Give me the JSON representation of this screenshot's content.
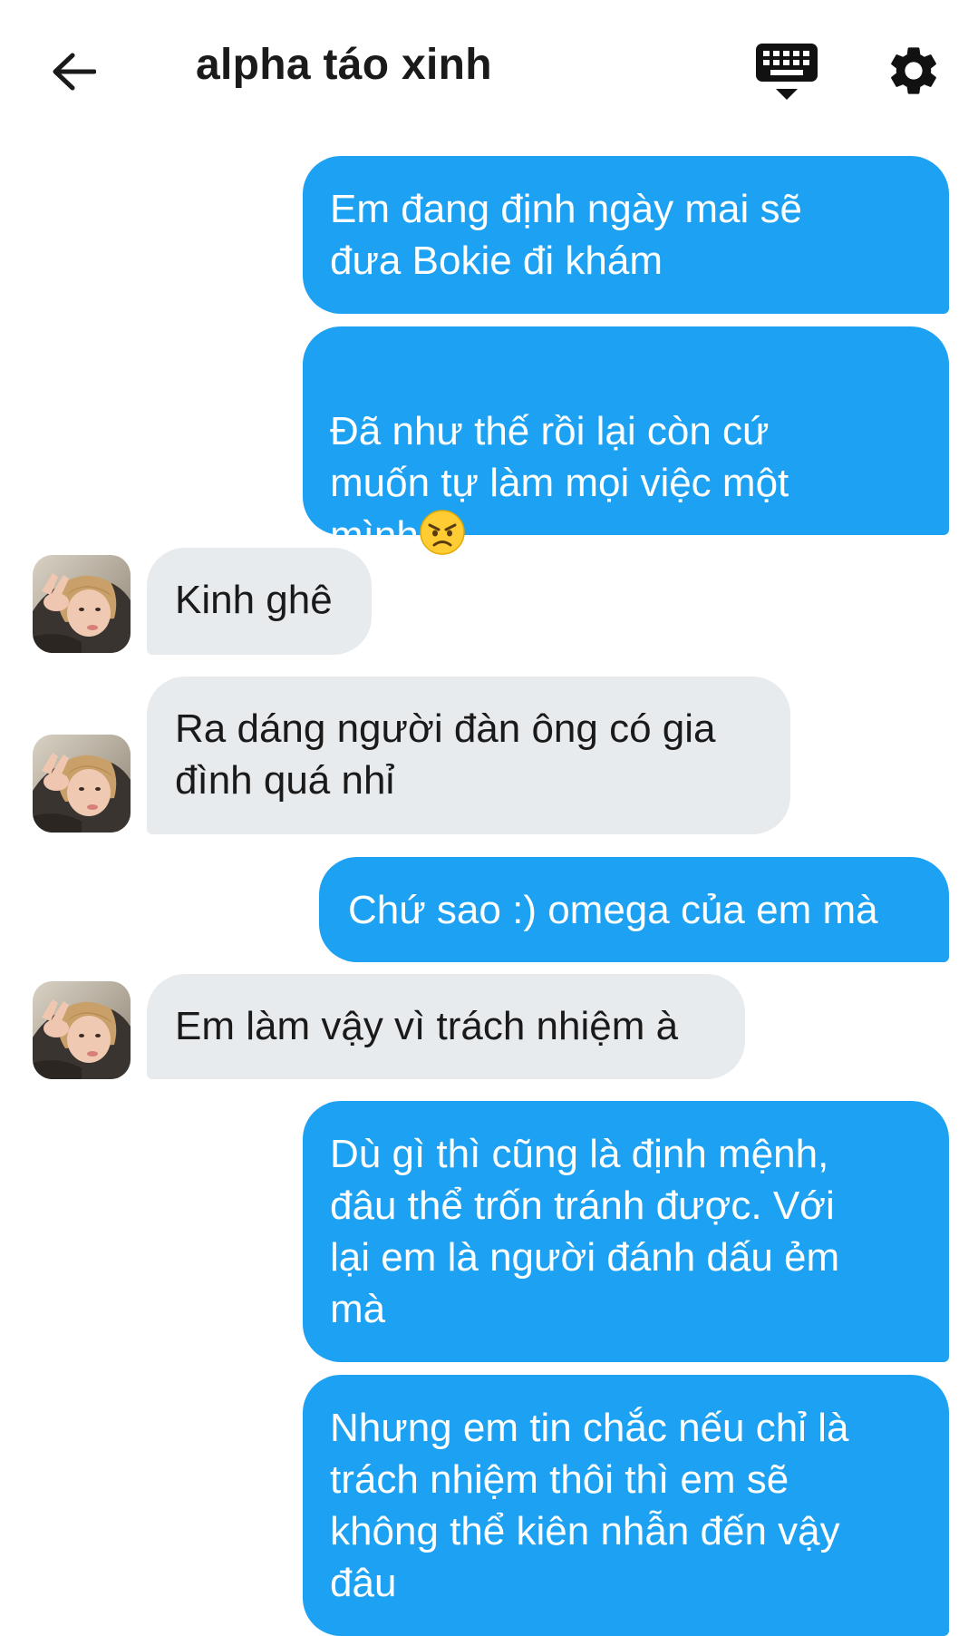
{
  "header": {
    "title": "alpha táo xinh"
  },
  "icons": {
    "back": "arrow-left-icon",
    "keyboard": "keyboard-icon",
    "settings": "gear-icon",
    "emoji": "angry-face-emoji"
  },
  "colors": {
    "outgoing_bubble": "#1da1f2",
    "incoming_bubble": "#e8ebee",
    "text_dark": "#1a1a1a"
  },
  "messages": [
    {
      "sender": "me",
      "text": "Em đang định ngày mai sẽ\nđưa Bokie đi khám"
    },
    {
      "sender": "me",
      "text": "Đã như thế rồi lại còn cứ\nmuốn tự làm mọi việc một\nmình"
    },
    {
      "sender": "other",
      "text": "Kinh ghê"
    },
    {
      "sender": "other",
      "text": "Ra dáng người đàn ông có gia\nđình quá nhỉ"
    },
    {
      "sender": "me",
      "text": "Chứ sao :) omega của em mà"
    },
    {
      "sender": "other",
      "text": "Em làm vậy vì trách nhiệm à"
    },
    {
      "sender": "me",
      "text": "Dù gì thì cũng là định mệnh,\nđâu thể trốn tránh được. Với\nlại em là người đánh dấu ẻm\nmà"
    },
    {
      "sender": "me",
      "text": "Nhưng em tin chắc nếu chỉ là\ntrách nhiệm thôi thì em sẽ\nkhông thể kiên nhẫn đến vậy\nđâu"
    }
  ]
}
